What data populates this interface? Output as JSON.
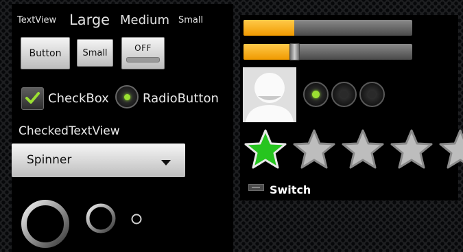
{
  "left_panel": {
    "text_sizes": {
      "textview": "TextView",
      "large": "Large",
      "medium": "Medium",
      "small": "Small"
    },
    "buttons": {
      "button": "Button",
      "small": "Small",
      "toggle": "OFF"
    },
    "checkbox": {
      "label": "CheckBox",
      "checked": true
    },
    "radio": {
      "label": "RadioButton",
      "checked": true
    },
    "checked_text_view": "CheckedTextView",
    "spinner": {
      "selected": "Spinner"
    }
  },
  "right_panel": {
    "progress_bar": {
      "value": 0.3
    },
    "seek_bar": {
      "value": 0.3
    },
    "radio_group": {
      "selected_index": 0,
      "count": 3
    },
    "rating_bar": {
      "rating": 1,
      "max": 5
    },
    "switch": {
      "label": "Switch"
    }
  },
  "colors": {
    "accent_green": "#9be032",
    "progress_orange": "#f7a800",
    "star_green": "#26c51f"
  }
}
